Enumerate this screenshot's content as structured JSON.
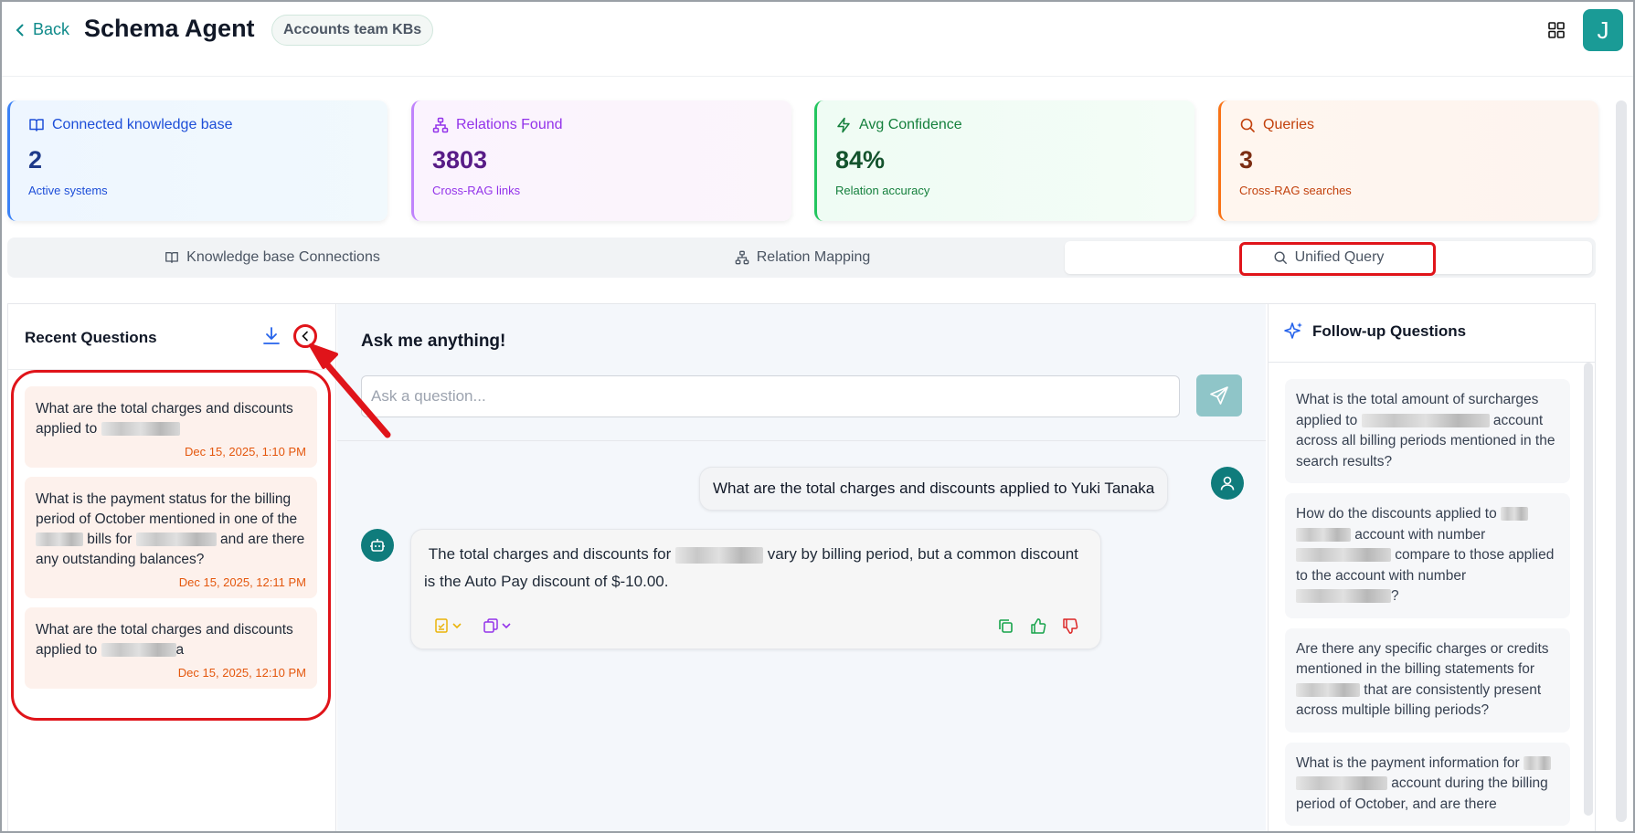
{
  "header": {
    "back_label": "Back",
    "title": "Schema Agent",
    "kb_badge": "Accounts team KBs",
    "avatar_initial": "J"
  },
  "stats": [
    {
      "title": "Connected knowledge base",
      "value": "2",
      "sub": "Active systems",
      "icon": "book-icon"
    },
    {
      "title": "Relations Found",
      "value": "3803",
      "sub": "Cross-RAG links",
      "icon": "network-icon"
    },
    {
      "title": "Avg Confidence",
      "value": "84%",
      "sub": "Relation accuracy",
      "icon": "bolt-icon"
    },
    {
      "title": "Queries",
      "value": "3",
      "sub": "Cross-RAG searches",
      "icon": "search-icon"
    }
  ],
  "tabs": [
    {
      "label": "Knowledge base Connections",
      "icon": "book-icon"
    },
    {
      "label": "Relation Mapping",
      "icon": "network-icon"
    },
    {
      "label": "Unified Query",
      "icon": "search-icon",
      "active": true
    }
  ],
  "recent": {
    "title": "Recent Questions",
    "items": [
      {
        "text_a": "What are the total charges and discounts applied to ",
        "text_b": "",
        "text_c": "",
        "date": "Dec 15, 2025, 1:10 PM"
      },
      {
        "text_a": "What is the payment status for the billing period of October mentioned in one of the ",
        "text_b": " bills for ",
        "text_c": " and are there any outstanding balances?",
        "date": "Dec 15, 2025, 12:11 PM"
      },
      {
        "text_a": "What are the total charges and discounts applied to ",
        "text_b": "a",
        "text_c": "",
        "date": "Dec 15, 2025, 12:10 PM"
      }
    ]
  },
  "chat": {
    "heading": "Ask me anything!",
    "placeholder": "Ask a question...",
    "user_message": "What are the total charges and discounts applied to Yuki Tanaka",
    "bot_text_a": "The total charges and discounts for ",
    "bot_text_b": " vary by billing period, but a common discount is the Auto Pay discount of $-10.00."
  },
  "followups": {
    "title": "Follow-up Questions",
    "items": [
      {
        "a": "What is the total amount of surcharges applied to ",
        "b": " account across all billing periods mentioned in the search results?"
      },
      {
        "a": "How do the discounts applied to ",
        "b": " account with number ",
        "c": " compare to those applied to the account with number ",
        "d": "?"
      },
      {
        "a": "Are there any specific charges or credits mentioned in the billing statements for ",
        "b": " that are consistently present across multiple billing periods?"
      },
      {
        "a": "What is the payment information for ",
        "b": " account during the billing period of October, and are there"
      }
    ]
  },
  "colors": {
    "accent": "#0f7c7c",
    "highlight": "#e0141a",
    "date": "#e4570d"
  }
}
